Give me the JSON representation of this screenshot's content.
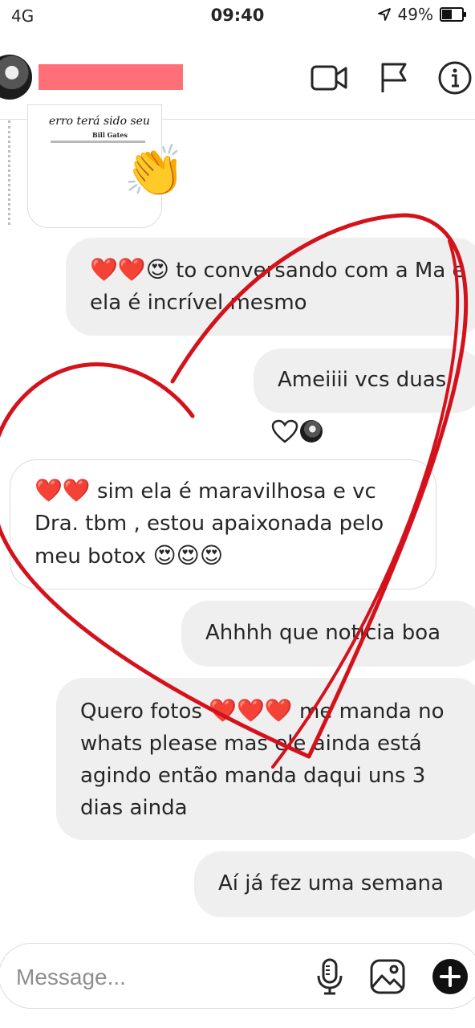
{
  "status_bar": {
    "carrier": "4G",
    "time": "09:40",
    "battery": "49%"
  },
  "header": {
    "icons": [
      "video-camera-icon",
      "flag-icon",
      "info-icon"
    ]
  },
  "shared_post": {
    "quote": "erro terá sido seu",
    "author": "Bill Gates",
    "reaction_emoji": "👏"
  },
  "messages": [
    {
      "sender": "them",
      "parts": [
        "❤️❤️😍",
        " to conversando com a Ma e ela é incrível mesmo"
      ]
    },
    {
      "sender": "me",
      "text": "Ameiiii vcs duas"
    },
    {
      "sender": "them",
      "parts": [
        "❤️❤️",
        " sim ela é maravilhosa e vc Dra.  tbm , estou apaixonada pelo meu botox ",
        "😍😍😍"
      ]
    },
    {
      "sender": "me",
      "text": "Ahhhh que notícia boa"
    },
    {
      "sender": "me",
      "parts": [
        "Quero fotos ",
        "❤️❤️❤️",
        " me manda no whats please mas ele ainda está agindo então manda daqui uns 3 dias ainda"
      ]
    },
    {
      "sender": "me",
      "text": "Aí já fez uma semana"
    }
  ],
  "reaction": {
    "heart_icon": "heart-outline-icon"
  },
  "composer": {
    "placeholder": "Message...",
    "icons": [
      "microphone-icon",
      "image-icon",
      "plus-icon"
    ]
  },
  "colors": {
    "bubble_gray": "#efefef",
    "redaction": "#ff6f77",
    "drawn_heart": "#d4121b"
  }
}
